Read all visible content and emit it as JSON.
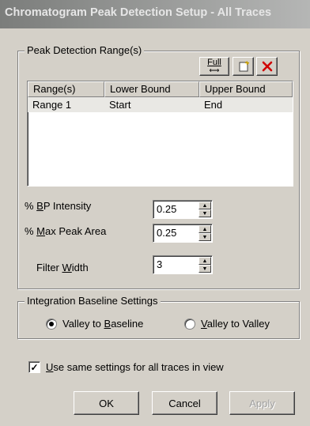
{
  "window": {
    "title": "Chromatogram Peak Detection Setup - All Traces"
  },
  "peak_range": {
    "group_label": "Peak Detection Range(s)",
    "toolbar": {
      "full_label": "Full",
      "new_icon": "new-document-icon",
      "delete_icon": "red-x-icon"
    },
    "columns": [
      "Range(s)",
      "Lower Bound",
      "Upper Bound"
    ],
    "rows": [
      {
        "name": "Range 1",
        "lower": "Start",
        "upper": "End"
      }
    ]
  },
  "params": {
    "bp_intensity": {
      "pre": "% ",
      "key": "B",
      "post": "P Intensity",
      "value": "0.25"
    },
    "max_peak_area": {
      "pre": "% ",
      "key": "M",
      "post": "ax Peak Area",
      "value": "0.25"
    },
    "filter_width": {
      "pre": "Filter ",
      "key": "W",
      "post": "idth",
      "value": "3"
    }
  },
  "baseline": {
    "group_label": "Integration Baseline Settings",
    "opt1": {
      "pre": "Valley to ",
      "key": "B",
      "post": "aseline",
      "selected": true
    },
    "opt2": {
      "pre": "",
      "key": "V",
      "post": "alley to Valley",
      "selected": false
    }
  },
  "same_settings": {
    "key": "U",
    "post": "se same settings for all traces in view",
    "checked": true
  },
  "buttons": {
    "ok": "OK",
    "cancel": "Cancel",
    "apply": "Apply"
  },
  "colors": {
    "face": "#d4d0c8",
    "title_start": "#7b7d7b",
    "title_end": "#b5b6b5",
    "selected_row": "#e9e8e4"
  }
}
